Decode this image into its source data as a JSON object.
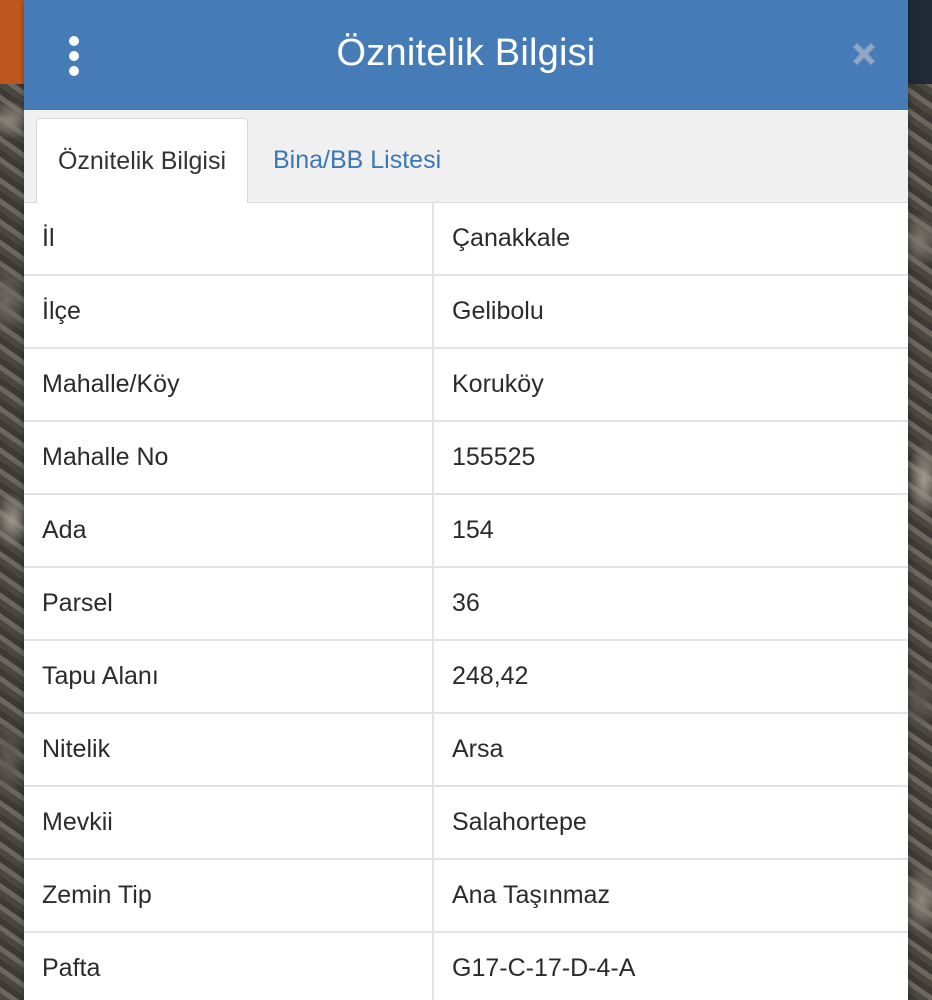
{
  "dialog": {
    "title": "Öznitelik Bilgisi"
  },
  "tabs": [
    {
      "label": "Öznitelik Bilgisi",
      "active": true
    },
    {
      "label": "Bina/BB Listesi",
      "active": false
    }
  ],
  "rows": [
    {
      "key": "İl",
      "value": "Çanakkale"
    },
    {
      "key": "İlçe",
      "value": "Gelibolu"
    },
    {
      "key": "Mahalle/Köy",
      "value": "Koruköy"
    },
    {
      "key": "Mahalle No",
      "value": "155525"
    },
    {
      "key": "Ada",
      "value": "154"
    },
    {
      "key": "Parsel",
      "value": "36"
    },
    {
      "key": "Tapu Alanı",
      "value": "248,42"
    },
    {
      "key": "Nitelik",
      "value": "Arsa"
    },
    {
      "key": "Mevkii",
      "value": "Salahortepe"
    },
    {
      "key": "Zemin Tip",
      "value": "Ana Taşınmaz"
    },
    {
      "key": "Pafta",
      "value": "G17-C-17-D-4-A"
    }
  ],
  "colors": {
    "titlebar": "#457cb8",
    "tab_link": "#3b78b5",
    "close_icon": "#8fa8c8"
  },
  "icons": {
    "menu": "vertical-ellipsis-icon",
    "close": "close-icon"
  }
}
